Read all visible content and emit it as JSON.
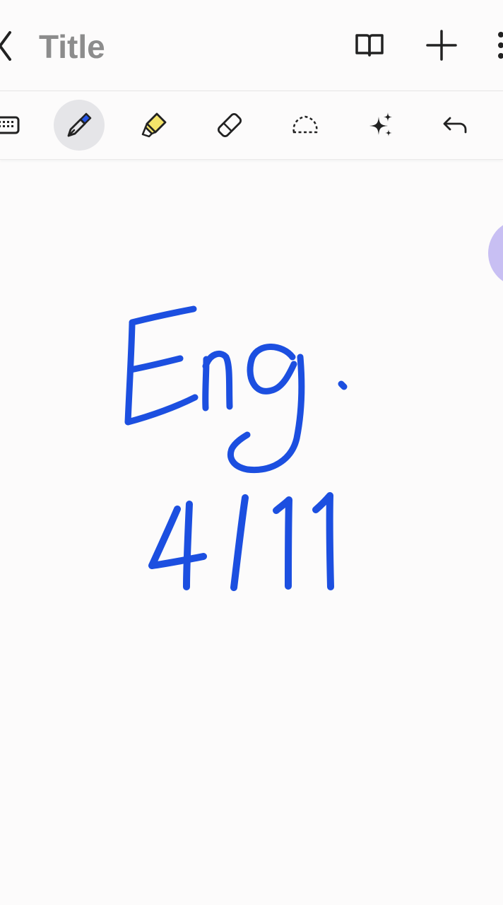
{
  "header": {
    "title": "Title",
    "back_icon": "chevron-left-icon",
    "icons": [
      "book-view-icon",
      "add-page-icon",
      "more-menu-icon"
    ]
  },
  "toolbar": {
    "tools": [
      {
        "name": "keyboard-tool",
        "icon": "keyboard-icon"
      },
      {
        "name": "pen-tool",
        "icon": "pen-icon",
        "selected": true
      },
      {
        "name": "highlighter-tool",
        "icon": "highlighter-icon"
      },
      {
        "name": "eraser-tool",
        "icon": "eraser-icon"
      },
      {
        "name": "lasso-tool",
        "icon": "lasso-icon"
      },
      {
        "name": "ai-assist-tool",
        "icon": "sparkle-icon"
      },
      {
        "name": "undo-tool",
        "icon": "undo-icon"
      }
    ]
  },
  "canvas": {
    "handwriting_line1": "Eng.",
    "handwriting_line2": "4/11"
  },
  "colors": {
    "ink": "#1c4fe0",
    "pen_accent": "#2454e6",
    "highlighter": "#f4e46a",
    "handle": "#c8bff3",
    "selected_tool_bg": "#e5e5e8",
    "title_text": "#8c8c8c"
  }
}
